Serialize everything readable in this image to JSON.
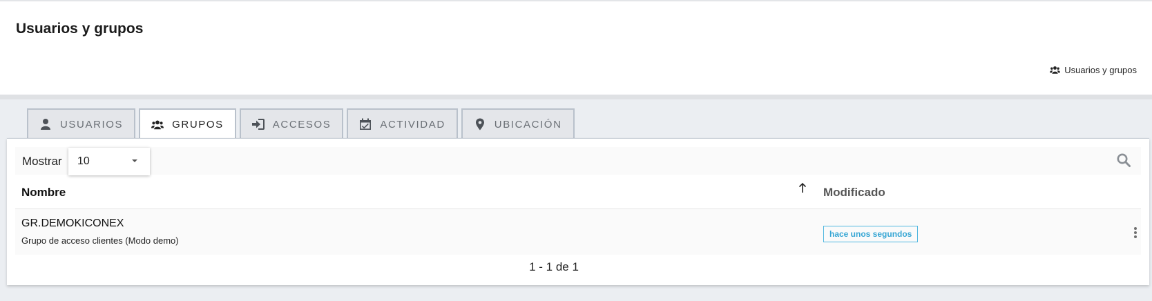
{
  "header": {
    "title": "Usuarios y grupos",
    "breadcrumb": {
      "label": "Usuarios y grupos",
      "icon": "users-icon"
    }
  },
  "tabs": [
    {
      "label": "Usuarios",
      "icon": "user-icon",
      "active": false
    },
    {
      "label": "Grupos",
      "icon": "users-icon",
      "active": true
    },
    {
      "label": "Accesos",
      "icon": "sign-in-icon",
      "active": false
    },
    {
      "label": "Actividad",
      "icon": "calendar-check-icon",
      "active": false
    },
    {
      "label": "Ubicación",
      "icon": "map-marker-icon",
      "active": false
    }
  ],
  "toolbar": {
    "show_label": "Mostrar",
    "page_size": "10",
    "search_icon": "search-icon"
  },
  "table": {
    "columns": [
      "Nombre",
      "Modificado"
    ],
    "sort": {
      "column": "Nombre",
      "direction": "asc"
    },
    "rows": [
      {
        "name": "GR.DEMOKICONEX",
        "description": "Grupo de acceso clientes (Modo demo)",
        "modified": "hace unos segundos"
      }
    ]
  },
  "pagination": {
    "text": "1 - 1 de 1"
  },
  "colors": {
    "accent": "#36a6d4",
    "tab_border": "#b9c1cb",
    "background": "#ebeef2"
  }
}
